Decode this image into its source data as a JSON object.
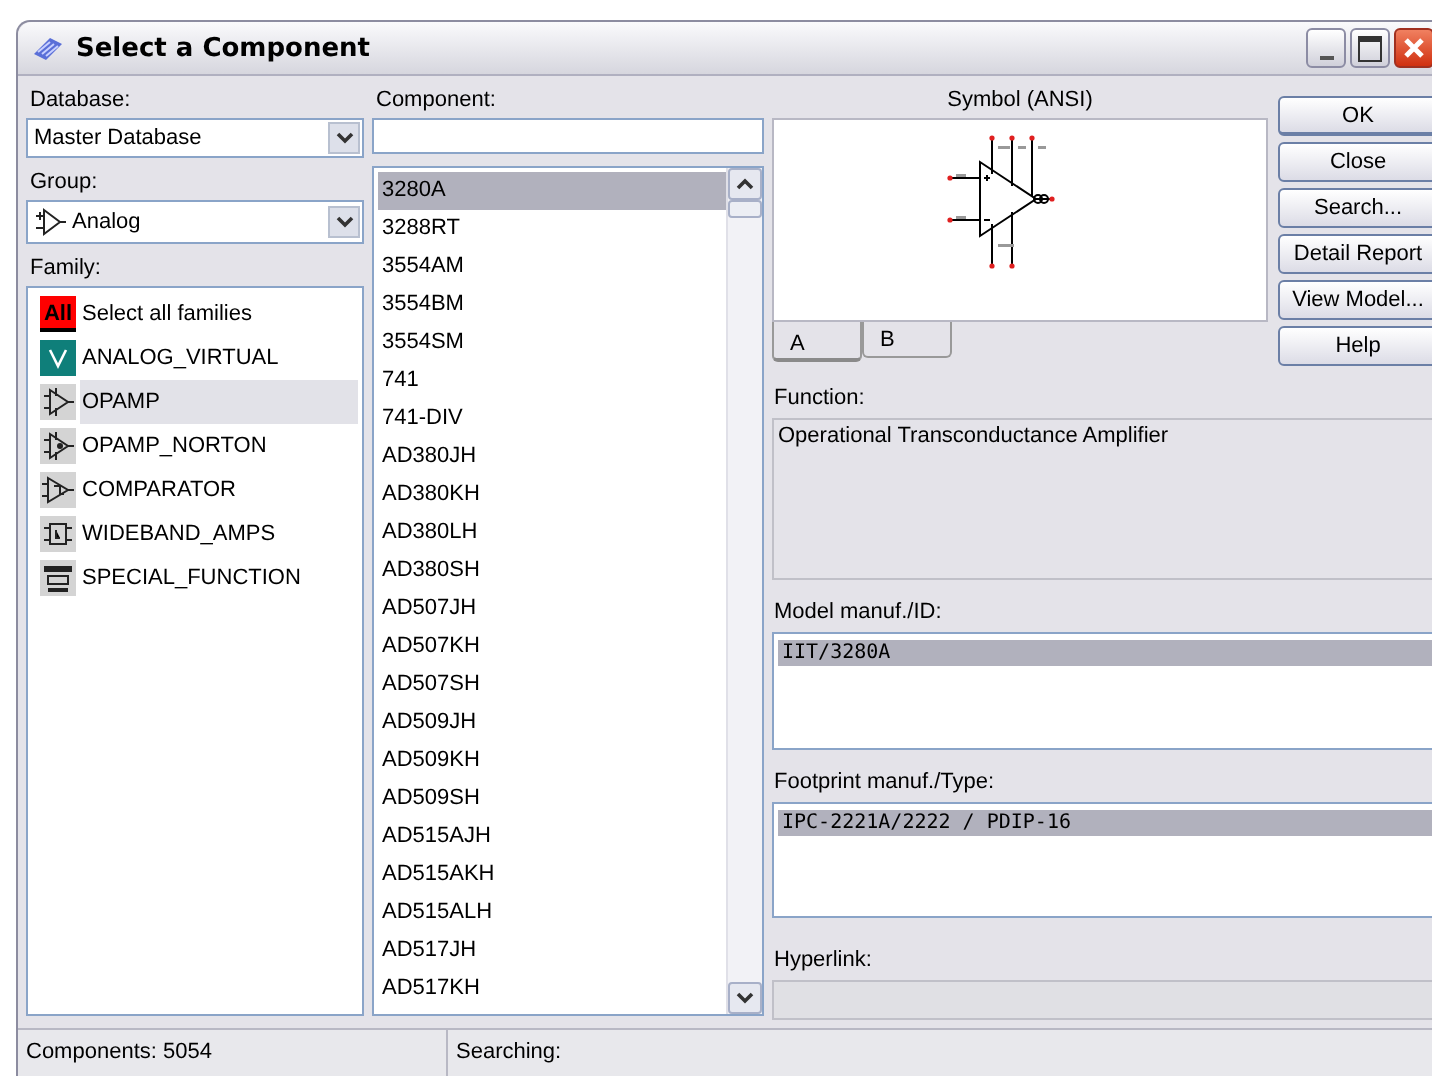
{
  "window": {
    "title": "Select a Component"
  },
  "database": {
    "label": "Database:",
    "value": "Master Database"
  },
  "group": {
    "label": "Group:",
    "value": "Analog"
  },
  "family": {
    "label": "Family:",
    "items": [
      {
        "kind": "all",
        "icon_text": "All",
        "label": "Select all families",
        "selected": false
      },
      {
        "kind": "virtual",
        "label": "ANALOG_VIRTUAL",
        "selected": false
      },
      {
        "kind": "opamp",
        "label": "OPAMP",
        "selected": true
      },
      {
        "kind": "norton",
        "label": "OPAMP_NORTON",
        "selected": false
      },
      {
        "kind": "comparator",
        "label": "COMPARATOR",
        "selected": false
      },
      {
        "kind": "wideband",
        "label": "WIDEBAND_AMPS",
        "selected": false
      },
      {
        "kind": "special",
        "label": "SPECIAL_FUNCTION",
        "selected": false
      }
    ]
  },
  "component": {
    "label": "Component:",
    "items": [
      {
        "label": "3280A",
        "selected": true
      },
      {
        "label": "3288RT",
        "selected": false
      },
      {
        "label": "3554AM",
        "selected": false
      },
      {
        "label": "3554BM",
        "selected": false
      },
      {
        "label": "3554SM",
        "selected": false
      },
      {
        "label": "741",
        "selected": false
      },
      {
        "label": "741-DIV",
        "selected": false
      },
      {
        "label": "AD380JH",
        "selected": false
      },
      {
        "label": "AD380KH",
        "selected": false
      },
      {
        "label": "AD380LH",
        "selected": false
      },
      {
        "label": "AD380SH",
        "selected": false
      },
      {
        "label": "AD507JH",
        "selected": false
      },
      {
        "label": "AD507KH",
        "selected": false
      },
      {
        "label": "AD507SH",
        "selected": false
      },
      {
        "label": "AD509JH",
        "selected": false
      },
      {
        "label": "AD509KH",
        "selected": false
      },
      {
        "label": "AD509SH",
        "selected": false
      },
      {
        "label": "AD515AJH",
        "selected": false
      },
      {
        "label": "AD515AKH",
        "selected": false
      },
      {
        "label": "AD515ALH",
        "selected": false
      },
      {
        "label": "AD517JH",
        "selected": false
      },
      {
        "label": "AD517KH",
        "selected": false
      }
    ]
  },
  "symbol": {
    "label": "Symbol (ANSI)",
    "tabs": [
      {
        "label": "A",
        "selected": true
      },
      {
        "label": "B",
        "selected": false
      }
    ]
  },
  "buttons": [
    "OK",
    "Close",
    "Search...",
    "Detail Report",
    "View Model...",
    "Help"
  ],
  "function": {
    "label": "Function:",
    "value": "Operational Transconductance Amplifier"
  },
  "model": {
    "label": "Model manuf./ID:",
    "items": [
      {
        "label": "IIT/3280A",
        "selected": true
      }
    ]
  },
  "footprint": {
    "label": "Footprint manuf./Type:",
    "items": [
      {
        "label": "IPC-2221A/2222 / PDIP-16",
        "selected": true
      }
    ]
  },
  "hyperlink": {
    "label": "Hyperlink:"
  },
  "status_bar": [
    "Components: 5054",
    "Searching:"
  ]
}
